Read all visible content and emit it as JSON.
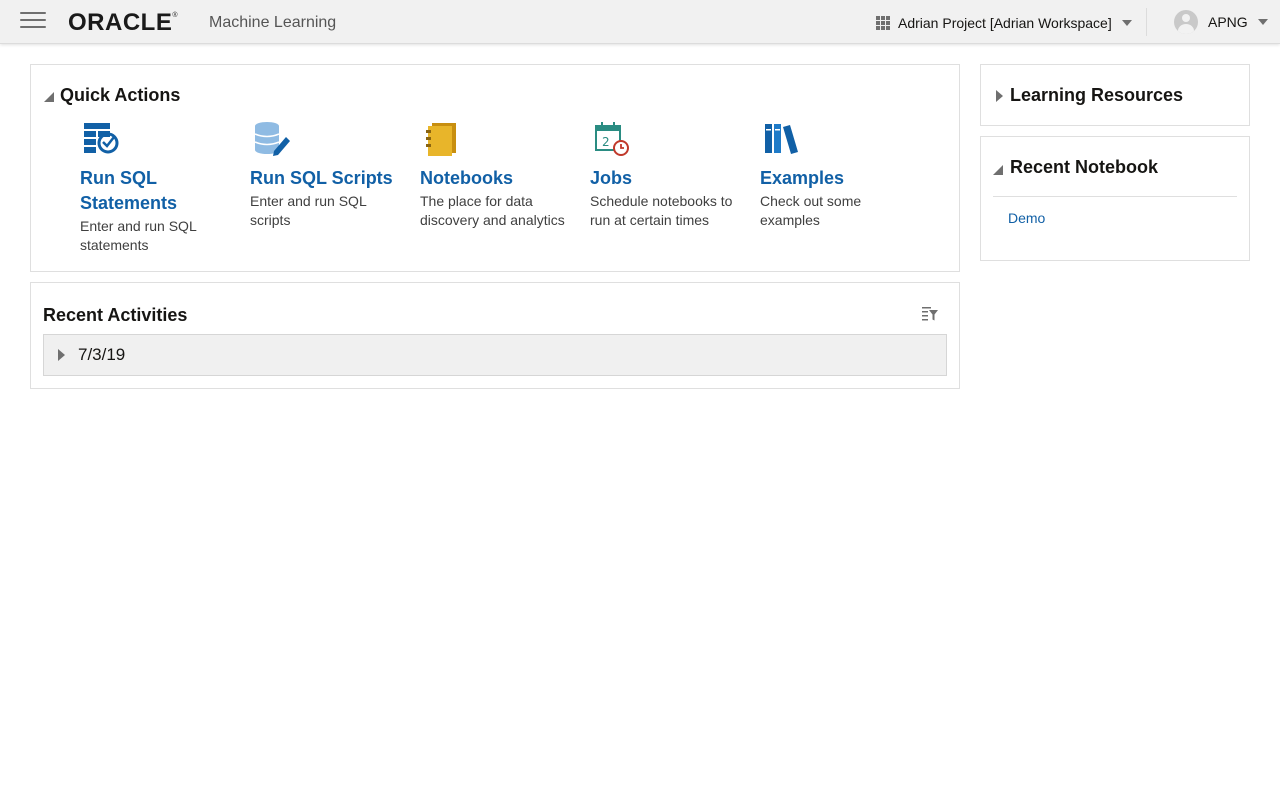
{
  "header": {
    "brand": "ORACLE",
    "brand_mark": "®",
    "product": "Machine Learning",
    "project_label": "Adrian Project [Adrian Workspace]",
    "user_label": "APNG"
  },
  "quick_actions": {
    "title": "Quick Actions",
    "items": [
      {
        "title_line1": "Run SQL",
        "title_line2": "Statements",
        "desc_line1": "Enter and run SQL",
        "desc_line2": "statements",
        "icon": "sql-statement-icon"
      },
      {
        "title_line1": "Run SQL Scripts",
        "title_line2": "",
        "desc_line1": "Enter and run SQL",
        "desc_line2": "scripts",
        "icon": "sql-script-icon"
      },
      {
        "title_line1": "Notebooks",
        "title_line2": "",
        "desc_line1": "The place for data",
        "desc_line2": "discovery and analytics",
        "icon": "notebook-icon"
      },
      {
        "title_line1": "Jobs",
        "title_line2": "",
        "desc_line1": "Schedule notebooks to",
        "desc_line2": "run at certain times",
        "icon": "calendar-clock-icon"
      },
      {
        "title_line1": "Examples",
        "title_line2": "",
        "desc_line1": "Check out some",
        "desc_line2": "examples",
        "icon": "books-icon"
      }
    ]
  },
  "recent_activities": {
    "title": "Recent Activities",
    "rows": [
      {
        "date": "7/3/19"
      }
    ]
  },
  "learning_resources": {
    "title": "Learning Resources"
  },
  "recent_notebook": {
    "title": "Recent Notebook",
    "items": [
      {
        "label": "Demo"
      }
    ]
  },
  "colors": {
    "link_blue": "#1160a6",
    "header_bg": "#f1f1f1",
    "notebook_yellow": "#e8b52a",
    "jobs_teal": "#2a8c82",
    "jobs_red": "#c0392b"
  }
}
